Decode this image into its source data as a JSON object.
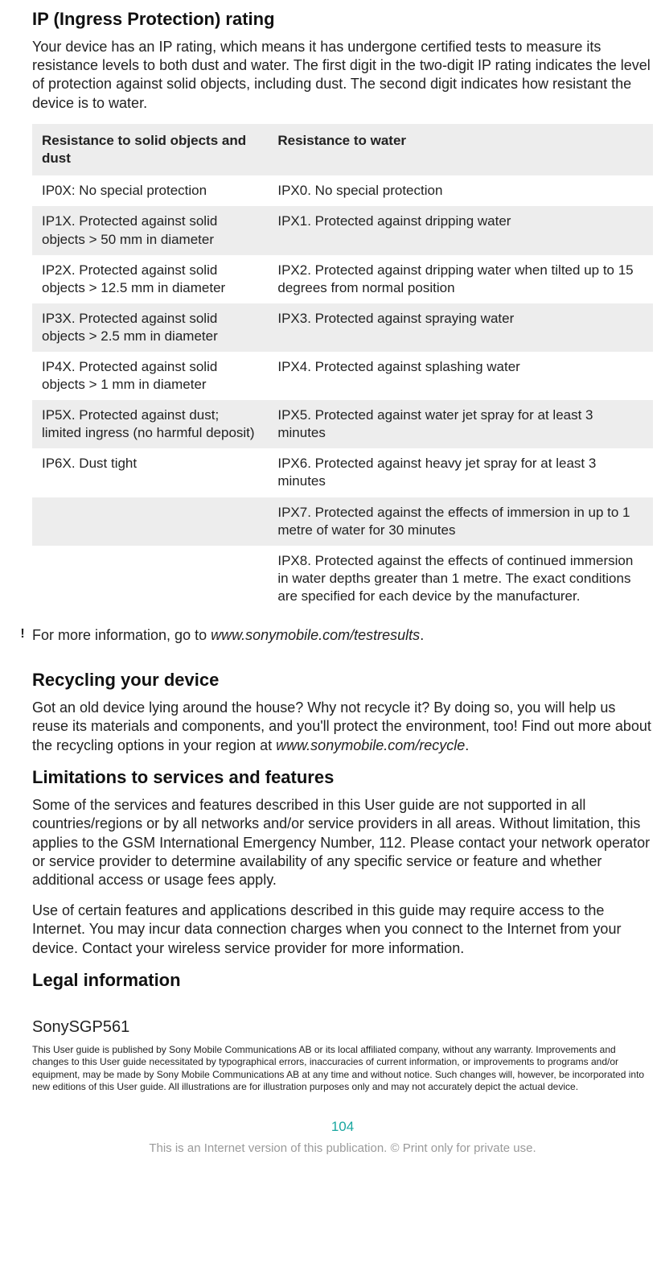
{
  "ip": {
    "heading": "IP (Ingress Protection) rating",
    "intro": "Your device has an IP rating, which means it has undergone certified tests to measure its resistance levels to both dust and water. The first digit in the two-digit IP rating indicates the level of protection against solid objects, including dust. The second digit indicates how resistant the device is to water.",
    "table_header_col1": "Resistance to solid objects and dust",
    "table_header_col2": "Resistance to water",
    "rows": [
      {
        "c1": "IP0X: No special protection",
        "c2": "IPX0. No special protection"
      },
      {
        "c1": "IP1X. Protected against solid objects > 50 mm in diameter",
        "c2": "IPX1. Protected against dripping water"
      },
      {
        "c1": "IP2X. Protected against solid objects > 12.5 mm in diameter",
        "c2": "IPX2. Protected against dripping water when tilted up to 15 degrees from normal position"
      },
      {
        "c1": "IP3X. Protected against solid objects > 2.5 mm in diameter",
        "c2": "IPX3. Protected against spraying water"
      },
      {
        "c1": "IP4X. Protected against solid objects > 1 mm in diameter",
        "c2": "IPX4. Protected against splashing water"
      },
      {
        "c1": "IP5X. Protected against dust; limited ingress (no harmful deposit)",
        "c2": "IPX5. Protected against water jet spray for at least 3 minutes"
      },
      {
        "c1": "IP6X. Dust tight",
        "c2": "IPX6. Protected against heavy jet spray for at least 3 minutes"
      },
      {
        "c1": "",
        "c2": "IPX7. Protected against the effects of immersion in up to 1 metre of water for 30 minutes"
      },
      {
        "c1": "",
        "c2": "IPX8. Protected against the effects of continued immersion in water depths greater than 1 metre. The exact conditions are specified for each device by the manufacturer."
      }
    ],
    "note_icon": "!",
    "note_prefix": "For more information, go to ",
    "note_link": "www.sonymobile.com/testresults",
    "note_suffix": "."
  },
  "recycling": {
    "heading": "Recycling your device",
    "body_prefix": "Got an old device lying around the house? Why not recycle it? By doing so, you will help us reuse its materials and components, and you'll protect the environment, too! Find out more about the recycling options in your region at ",
    "link": "www.sonymobile.com/recycle",
    "body_suffix": "."
  },
  "limitations": {
    "heading": "Limitations to services and features",
    "p1": "Some of the services and features described in this User guide are not supported in all countries/regions or by all networks and/or service providers in all areas. Without limitation, this applies to the GSM International Emergency Number, 112. Please contact your network operator or service provider to determine availability of any specific service or feature and whether additional access or usage fees apply.",
    "p2": "Use of certain features and applications described in this guide may require access to the Internet. You may incur data connection charges when you connect to the Internet from your device. Contact your wireless service provider for more information."
  },
  "legal": {
    "heading": "Legal information",
    "device_model": "SonySGP561",
    "small": "This User guide is published by Sony Mobile Communications AB or its local affiliated company, without any warranty. Improvements and changes to this User guide necessitated by typographical errors, inaccuracies of current information, or improvements to programs and/or equipment, may be made by Sony Mobile Communications AB at any time and without notice. Such changes will, however, be incorporated into new editions of this User guide. All illustrations are for illustration purposes only and may not accurately depict the actual device."
  },
  "page_number": "104",
  "footer": "This is an Internet version of this publication. © Print only for private use."
}
